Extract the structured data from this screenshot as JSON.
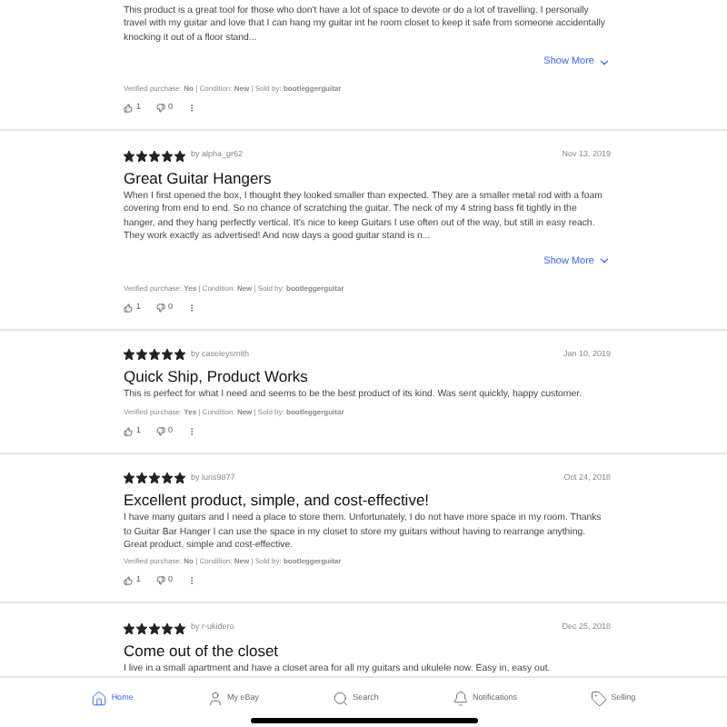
{
  "reviews": [
    {
      "body": "This product is a great tool for those who don't have a lot of space to devote or do a lot of travelling. I personally travel with my guitar and love that I can hang my guitar int he room closet to keep it safe from someone accidentally knocking it out of a floor stand...",
      "show_more": "Show More",
      "meta": "Verified purchase: **No** | Condition: **New** | Sold by: **bootleggerguitar**",
      "helpful": "1",
      "unhelpful": "0"
    },
    {
      "stars": 5,
      "author": "by alpha_gr62",
      "date": "Nov 13, 2019",
      "title": "Great Guitar Hangers",
      "body": "When I first opened the box, I thought they looked smaller than expected. They are a smaller metal rod with a foam covering from end to end. So no chance of scratching the guitar. The neck of my 4 string bass fit tightly in the hanger, and they hang perfectly vertical. It's nice to keep Guitars I use often out of the way, but still in easy reach. They work exactly as advertised! And now days a good guitar stand is n...",
      "show_more": "Show More",
      "meta": "Verified purchase: **Yes** | Condition: **New** | Sold by: **bootleggerguitar**",
      "helpful": "1",
      "unhelpful": "0"
    },
    {
      "stars": 5,
      "author": "by caseleysmith",
      "date": "Jan 10, 2019",
      "title": "Quick Ship, Product Works",
      "body": "This is perfect for what I need and seems to be the best product of its kind.  Was sent quickly, happy customer.",
      "meta": "Verified purchase: **Yes** | Condition: **New** | Sold by: **bootleggerguitar**",
      "helpful": "1",
      "unhelpful": "0"
    },
    {
      "stars": 5,
      "author": "by luris9877",
      "date": "Oct 24, 2018",
      "title": "Excellent product, simple, and cost-effective!",
      "body": "I have many guitars and I need a place to store them. Unfortunately, I do not have more space in my room. Thanks to Guitar Bar Hanger I can use the space in my closet to store my guitars without having to rearrange anything. Great product, simple and cost-effective.",
      "meta": "Verified purchase: **No** | Condition: **New** | Sold by: **bootleggerguitar**",
      "helpful": "1",
      "unhelpful": "0"
    },
    {
      "stars": 5,
      "author": "by r-ukidero",
      "date": "Dec 25, 2018",
      "title": "Come out of the closet",
      "body": "I live in a small apartment and have a closet area for all my guitars and ukulele now. Easy in, easy out."
    }
  ],
  "nav": [
    {
      "label": "Home",
      "selected": true
    },
    {
      "label": "My eBay",
      "selected": false
    },
    {
      "label": "Search",
      "selected": false
    },
    {
      "label": "Notifications",
      "selected": false
    },
    {
      "label": "Selling",
      "selected": false
    }
  ]
}
